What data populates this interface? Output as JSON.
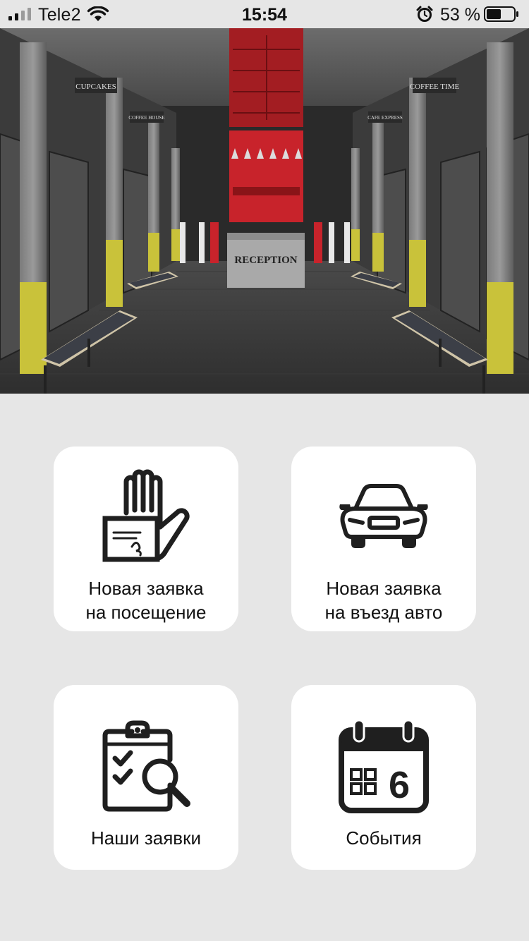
{
  "status_bar": {
    "carrier": "Tele2",
    "time": "15:54",
    "battery_percent": "53 %",
    "battery_level": 0.53,
    "signal_bars": 2,
    "icons": [
      "signal-icon",
      "wifi-icon",
      "alarm-icon",
      "battery-icon"
    ]
  },
  "hero": {
    "signs": {
      "reception": "RECEPTION",
      "cupcakes": "CUPCAKES",
      "coffee_time": "COFFEE TIME",
      "coffee_house": "COFFEE HOUSE",
      "cafe_express": "CAFE EXPRESS"
    }
  },
  "tiles": [
    {
      "label": "Новая заявка\nна посещение",
      "icon": "hand-pass-icon"
    },
    {
      "label": "Новая заявка\nна въезд авто",
      "icon": "car-icon"
    },
    {
      "label": "Наши заявки",
      "icon": "clipboard-search-icon"
    },
    {
      "label": "События",
      "icon": "calendar-icon",
      "calendar_number": "6"
    }
  ],
  "colors": {
    "background": "#e6e6e6",
    "tile": "#ffffff",
    "icon": "#1f1f1f",
    "accent_red": "#c8232b",
    "accent_yellow": "#c9c23a"
  }
}
